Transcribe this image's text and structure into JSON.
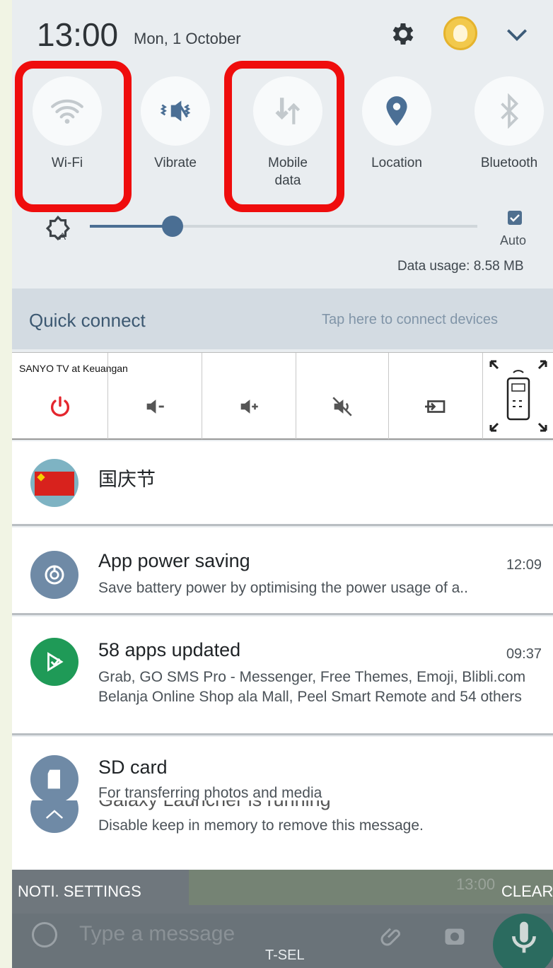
{
  "status": {
    "time": "13:00",
    "date": "Mon, 1 October"
  },
  "quick_settings": [
    {
      "label": "Wi-Fi",
      "icon": "wifi-icon",
      "active": false,
      "highlighted": true
    },
    {
      "label": "Vibrate",
      "icon": "vibrate-icon",
      "active": true,
      "highlighted": false
    },
    {
      "label": "Mobile data",
      "icon": "mobile-data-icon",
      "active": false,
      "highlighted": true
    },
    {
      "label": "Location",
      "icon": "location-pin-icon",
      "active": true,
      "highlighted": false
    },
    {
      "label": "Bluetooth",
      "icon": "bluetooth-icon",
      "active": false,
      "highlighted": false
    }
  ],
  "brightness": {
    "level_fraction": 0.22,
    "auto_label": "Auto",
    "auto_checked": true
  },
  "data_usage": "Data usage: 8.58 MB",
  "quick_connect": {
    "title": "Quick connect",
    "hint": "Tap here to connect devices"
  },
  "remote": {
    "title": "SANYO TV at Keuangan",
    "buttons": [
      "power-icon",
      "volume-down-icon",
      "volume-up-icon",
      "mute-icon",
      "input-source-icon",
      "remote-expand-icon"
    ]
  },
  "notifications": [
    {
      "title": "国庆节",
      "time": "",
      "text": "",
      "icon": "china-flag-icon"
    },
    {
      "title": "App power saving",
      "time": "12:09",
      "text": "Save battery power by optimising the power usage of a..",
      "icon": "power-saving-icon"
    },
    {
      "title": "58 apps updated",
      "time": "09:37",
      "text": "Grab, GO SMS Pro - Messenger, Free Themes, Emoji, Blibli.com Belanja Online Shop ala Mall, Peel Smart Remote and 54 others",
      "icon": "play-store-icon"
    },
    {
      "title": "SD card",
      "time": "",
      "text": "For transferring photos and media",
      "icon": "sd-card-icon"
    },
    {
      "title": "Galaxy Launcher is running",
      "time": "",
      "text": "Disable keep in memory to remove this message.",
      "icon": "home-icon"
    }
  ],
  "footer": {
    "settings_label": "NOTI. SETTINGS",
    "clear_label": "CLEAR",
    "ghost_time": "13:00",
    "message_placeholder": "Type a message",
    "carrier": "T-SEL"
  },
  "colors": {
    "highlight": "#ef0d0d",
    "accent": "#4a6e93",
    "active_icon": "#4b6f95",
    "inactive_icon": "#c3c9cd"
  }
}
